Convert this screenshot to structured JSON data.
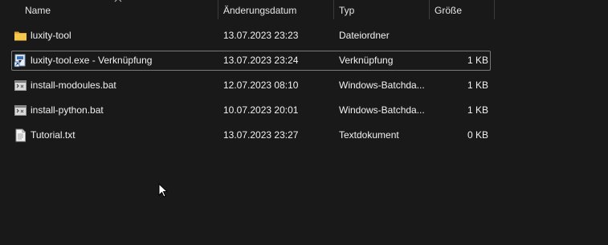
{
  "columns": {
    "name": "Name",
    "date": "Änderungsdatum",
    "type": "Typ",
    "size": "Größe"
  },
  "files": [
    {
      "name": "luxity-tool",
      "date": "13.07.2023 23:23",
      "type": "Dateiordner",
      "size": "",
      "icon": "folder-icon"
    },
    {
      "name": "luxity-tool.exe - Verknüpfung",
      "date": "13.07.2023 23:24",
      "type": "Verknüpfung",
      "size": "1 KB",
      "icon": "shortcut-icon"
    },
    {
      "name": "install-modoules.bat",
      "date": "12.07.2023 08:10",
      "type": "Windows-Batchda...",
      "size": "1 KB",
      "icon": "batch-file-icon"
    },
    {
      "name": "install-python.bat",
      "date": "10.07.2023 20:01",
      "type": "Windows-Batchda...",
      "size": "1 KB",
      "icon": "batch-file-icon"
    },
    {
      "name": "Tutorial.txt",
      "date": "13.07.2023 23:27",
      "type": "Textdokument",
      "size": "0 KB",
      "icon": "text-file-icon"
    }
  ],
  "colors": {
    "background": "#191919",
    "text": "#f2f2f2",
    "folder": "#f0c043",
    "selection_border": "#7a7a7a"
  }
}
